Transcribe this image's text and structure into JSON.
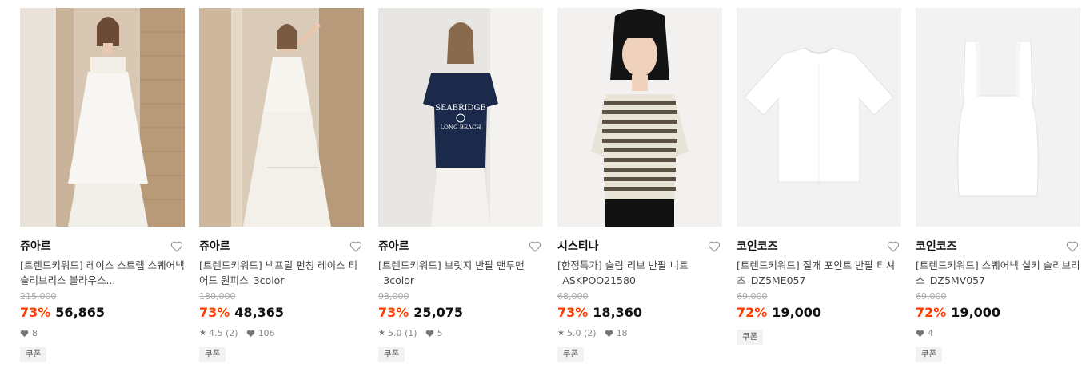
{
  "products": [
    {
      "brand": "쥬아르",
      "name": "[트렌드키워드] 레이스 스트랩 스퀘어넥 슬리브리스 블라우스...",
      "original_price": "215,000",
      "discount": "73%",
      "price": "56,865",
      "rating": "",
      "review_count": "",
      "likes": "8",
      "coupon": "쿠폰"
    },
    {
      "brand": "쥬아르",
      "name": "[트렌드키워드] 넥프릴 펀칭 레이스 티어드 원피스_3color",
      "original_price": "180,000",
      "discount": "73%",
      "price": "48,365",
      "rating": "4.5",
      "review_count": "(2)",
      "likes": "106",
      "coupon": "쿠폰"
    },
    {
      "brand": "쥬아르",
      "name": "[트렌드키워드] 브릿지 반팔 맨투맨_3color",
      "original_price": "93,000",
      "discount": "73%",
      "price": "25,075",
      "rating": "5.0",
      "review_count": "(1)",
      "likes": "5",
      "coupon": "쿠폰",
      "shirt_print": [
        "SEABRIDGE",
        "LONG BEACH"
      ]
    },
    {
      "brand": "시스티나",
      "name": "[한정특가] 슬림 리브 반팔 니트_ASKPOO21580",
      "original_price": "68,000",
      "discount": "73%",
      "price": "18,360",
      "rating": "5.0",
      "review_count": "(2)",
      "likes": "18",
      "coupon": "쿠폰"
    },
    {
      "brand": "코인코즈",
      "name": "[트렌드키워드] 절개 포인트 반팔 티셔츠_DZ5ME057",
      "original_price": "69,000",
      "discount": "72%",
      "price": "19,000",
      "rating": "",
      "review_count": "",
      "likes": "",
      "coupon": "쿠폰"
    },
    {
      "brand": "코인코즈",
      "name": "[트렌드키워드] 스퀘어넥 실키 슬리브리스_DZ5MV057",
      "original_price": "69,000",
      "discount": "72%",
      "price": "19,000",
      "rating": "",
      "review_count": "",
      "likes": "4",
      "coupon": "쿠폰"
    }
  ],
  "icons": {
    "wishlist": "heart-outline-icon",
    "rating": "star-icon",
    "likes": "heart-filled-icon"
  },
  "colors": {
    "discount": "#ff3b00",
    "price": "#111111",
    "original_price": "#aaaaaa",
    "coupon_bg": "#f2f2f2"
  }
}
